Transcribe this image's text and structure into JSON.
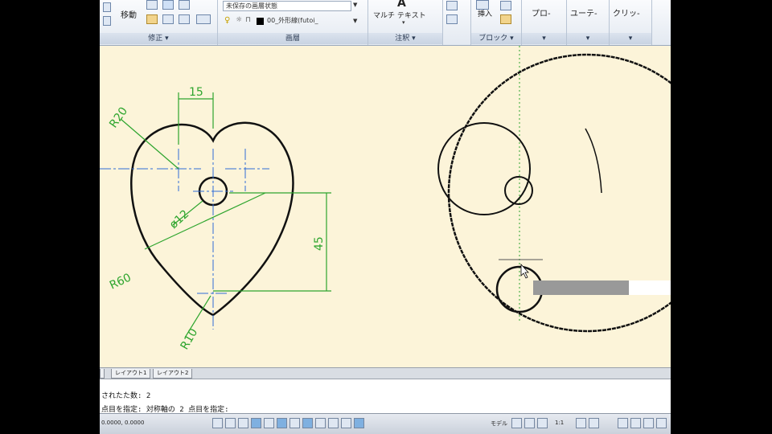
{
  "ribbon": {
    "modify": {
      "move_label": "移動",
      "panel_title": "修正 ▾"
    },
    "layers": {
      "state_combo": "未保存の画層状態",
      "layer_combo": "00_外形線(futoi_",
      "panel_title": "画層"
    },
    "annotation": {
      "mtext_label": "マルチ テキスト",
      "panel_title": "注釈 ▾"
    },
    "block": {
      "insert_label": "挿入",
      "panel_title": "ブロック ▾"
    },
    "extra_panels": [
      "プロ-",
      "ユーテ-",
      "クリッ-"
    ]
  },
  "dimensions": {
    "width_15": "15",
    "r20": "R20",
    "dia12": "ø12",
    "d45": "45",
    "r60": "R60",
    "r10": "R10"
  },
  "tabs": [
    "レイアウト1",
    "レイアウト2"
  ],
  "command": {
    "line1": "されたた数: 2",
    "line2": "点目を指定: 対称軸の 2 点目を指定:",
    "coords": "0.0000, 0.0000"
  },
  "status": {
    "model_label": "モデル",
    "scale_label": "1:1"
  },
  "colors": {
    "canvas": "#fcf4d9",
    "dimension": "#2ea52e",
    "centerline": "#2f6bd6",
    "outline": "#111111"
  }
}
